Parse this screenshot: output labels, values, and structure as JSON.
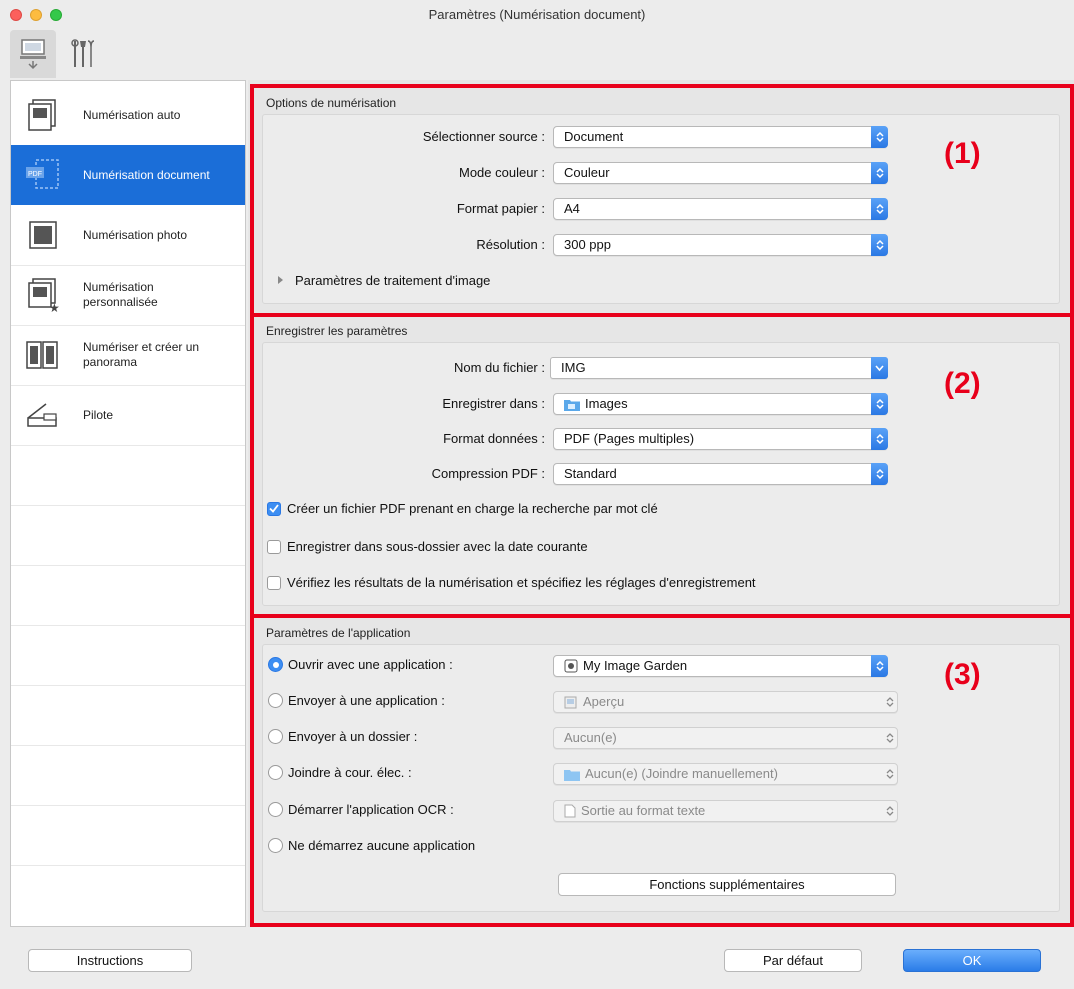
{
  "window": {
    "title": "Paramètres (Numérisation document)"
  },
  "toolbar": {
    "tabs": [
      {
        "icon": "computer-scan-icon"
      },
      {
        "icon": "tools-icon"
      }
    ]
  },
  "sidebar": {
    "items": [
      {
        "label": "Numérisation auto",
        "icon": "auto-scan-icon"
      },
      {
        "label": "Numérisation document",
        "icon": "document-scan-icon",
        "selected": true
      },
      {
        "label": "Numérisation photo",
        "icon": "photo-scan-icon"
      },
      {
        "label": "Numérisation\npersonnalisée",
        "icon": "custom-scan-icon"
      },
      {
        "label": "Numériser et créer un\npanorama",
        "icon": "panorama-icon"
      },
      {
        "label": "Pilote",
        "icon": "driver-icon"
      }
    ]
  },
  "section1": {
    "title": "Options de numérisation",
    "number": "(1)",
    "source_label": "Sélectionner source :",
    "source_value": "Document",
    "color_label": "Mode couleur :",
    "color_value": "Couleur",
    "paper_label": "Format papier :",
    "paper_value": "A4",
    "resolution_label": "Résolution :",
    "resolution_value": "300 ppp",
    "image_processing": "Paramètres de traitement d'image"
  },
  "section2": {
    "title": "Enregistrer les paramètres",
    "number": "(2)",
    "filename_label": "Nom du fichier :",
    "filename_value": "IMG",
    "savein_label": "Enregistrer dans :",
    "savein_value": "Images",
    "format_label": "Format données :",
    "format_value": "PDF (Pages multiples)",
    "compression_label": "Compression PDF :",
    "compression_value": "Standard",
    "check_keyword": "Créer un fichier PDF prenant en charge la recherche par mot clé",
    "check_subfolder": "Enregistrer dans sous-dossier avec la date courante",
    "check_verify": "Vérifiez les résultats de la numérisation et spécifiez les réglages d'enregistrement"
  },
  "section3": {
    "title": "Paramètres de l'application",
    "number": "(3)",
    "open_app_label": "Ouvrir avec une application :",
    "open_app_value": "My Image Garden",
    "send_app_label": "Envoyer à une application :",
    "send_app_value": "Aperçu",
    "send_folder_label": "Envoyer à un dossier :",
    "send_folder_value": "Aucun(e)",
    "email_label": "Joindre à cour. élec. :",
    "email_value": "Aucun(e) (Joindre manuellement)",
    "ocr_label": "Démarrer l'application OCR :",
    "ocr_value": "Sortie au format texte",
    "none_label": "Ne démarrez aucune application",
    "more_functions": "Fonctions supplémentaires"
  },
  "footer": {
    "instructions": "Instructions",
    "defaults": "Par défaut",
    "ok": "OK"
  },
  "colors": {
    "accent": "#1b6ed8",
    "highlight": "#e8001b"
  }
}
